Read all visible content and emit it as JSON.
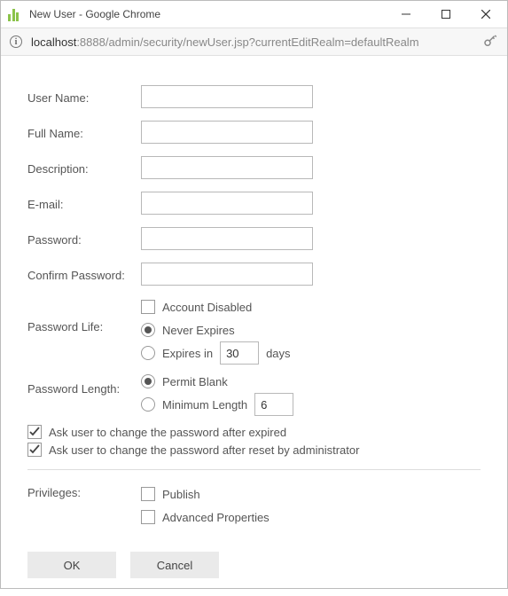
{
  "window": {
    "title": "New User - Google Chrome"
  },
  "url": {
    "host": "localhost",
    "rest": ":8888/admin/security/newUser.jsp?currentEditRealm=defaultRealm"
  },
  "labels": {
    "userName": "User Name:",
    "fullName": "Full Name:",
    "description": "Description:",
    "email": "E-mail:",
    "password": "Password:",
    "confirmPassword": "Confirm Password:",
    "passwordLife": "Password Life:",
    "passwordLength": "Password Length:",
    "privileges": "Privileges:"
  },
  "options": {
    "accountDisabled": "Account Disabled",
    "neverExpires": "Never Expires",
    "expiresInPrefix": "Expires in",
    "expiresInSuffix": "days",
    "expiresInValue": "30",
    "permitBlank": "Permit Blank",
    "minimumLength": "Minimum Length",
    "minimumLengthValue": "6",
    "askAfterExpired": "Ask user to change the password after expired",
    "askAfterReset": "Ask user to change the password after reset by administrator",
    "publish": "Publish",
    "advancedProps": "Advanced Properties"
  },
  "buttons": {
    "ok": "OK",
    "cancel": "Cancel"
  }
}
